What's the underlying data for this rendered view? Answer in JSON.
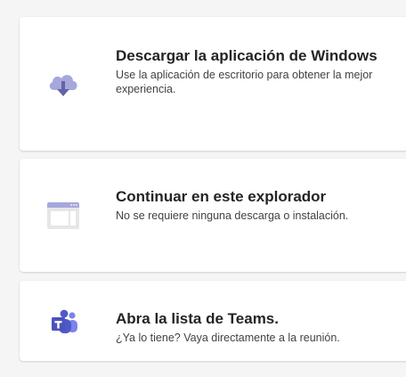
{
  "options": [
    {
      "title": "Descargar la aplicación de Windows",
      "description": "Use la aplicación de escritorio para obtener la mejor experiencia.",
      "icon": "cloud-download-icon"
    },
    {
      "title": "Continuar en este explorador",
      "description": "No se requiere ninguna descarga o instalación.",
      "icon": "browser-window-icon"
    },
    {
      "title": "Abra la lista de Teams.",
      "description": "¿Ya lo tiene? Vaya directamente a la reunión.",
      "icon": "teams-logo-icon"
    }
  ],
  "colors": {
    "accent": "#6264A7",
    "accent_light": "#A6A7DC",
    "card_background": "#FFFFFF",
    "page_background": "#F5F5F5"
  }
}
